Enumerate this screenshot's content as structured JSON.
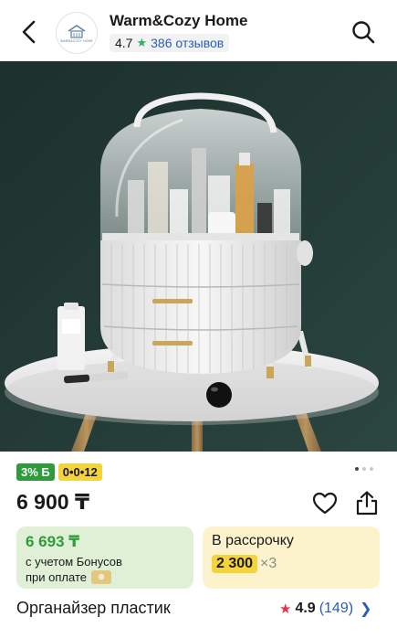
{
  "header": {
    "shop_name": "Warm&Cozy Home",
    "shop_rating": "4.7",
    "shop_reviews": "386 отзывов",
    "logo_text": "WARM&COZY HOME",
    "back_icon": "chevron-left-icon",
    "search_icon": "search-icon"
  },
  "gallery": {
    "total_images": 3,
    "active_index": 0
  },
  "promo": {
    "cashback": "3% Б",
    "timer": "0•0•12"
  },
  "product": {
    "price": "6 900 ₸",
    "title": "Органайзер пластик",
    "rating": "4.9",
    "reviews_count": "(149)"
  },
  "bonus_card": {
    "price": "6 693 ₸",
    "line1": "с учетом Бонусов",
    "line2": "при оплате"
  },
  "installment": {
    "label": "В рассрочку",
    "amount": "2 300",
    "times": "×3"
  },
  "colors": {
    "accent_green": "#2f9c3c",
    "accent_yellow": "#f5d33a",
    "link_blue": "#2a5db8",
    "star_red": "#e4334a"
  }
}
